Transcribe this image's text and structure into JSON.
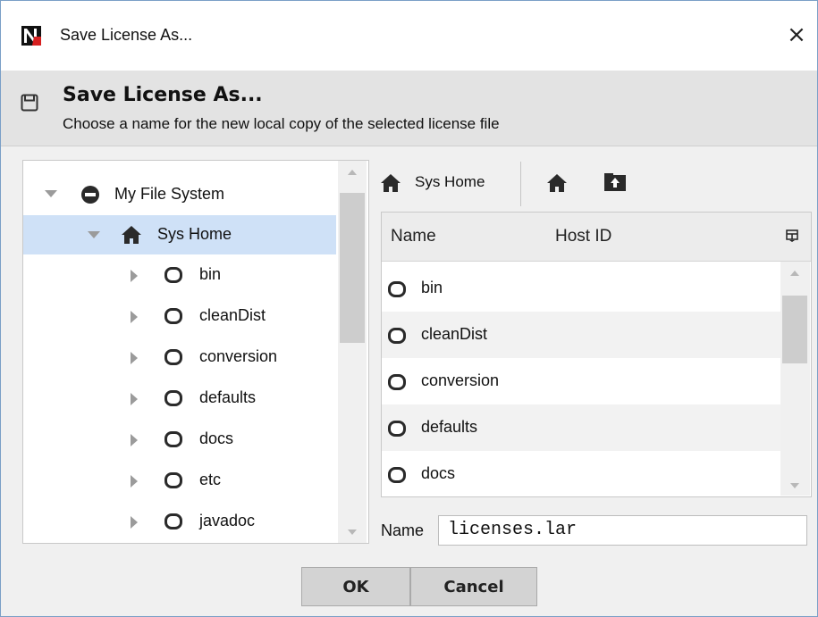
{
  "window": {
    "title": "Save License As...",
    "close": "×"
  },
  "header": {
    "title": "Save License As...",
    "subtitle": "Choose a name for the new local copy of the selected license file"
  },
  "tree": {
    "root": "My File System",
    "selected": "Sys Home",
    "children": [
      "bin",
      "cleanDist",
      "conversion",
      "defaults",
      "docs",
      "etc",
      "javadoc"
    ]
  },
  "nav": {
    "current": "Sys Home",
    "home_icon": "home-icon",
    "up_icon": "folder-up-icon"
  },
  "table": {
    "columns": [
      "Name",
      "Host ID"
    ],
    "rows": [
      "bin",
      "cleanDist",
      "conversion",
      "defaults",
      "docs"
    ]
  },
  "name_field": {
    "label": "Name",
    "value": "licenses.lar"
  },
  "buttons": {
    "ok": "OK",
    "cancel": "Cancel"
  },
  "colors": {
    "selection": "#cfe1f7",
    "header_bg": "#e3e3e3",
    "button_bg": "#d3d3d3"
  }
}
